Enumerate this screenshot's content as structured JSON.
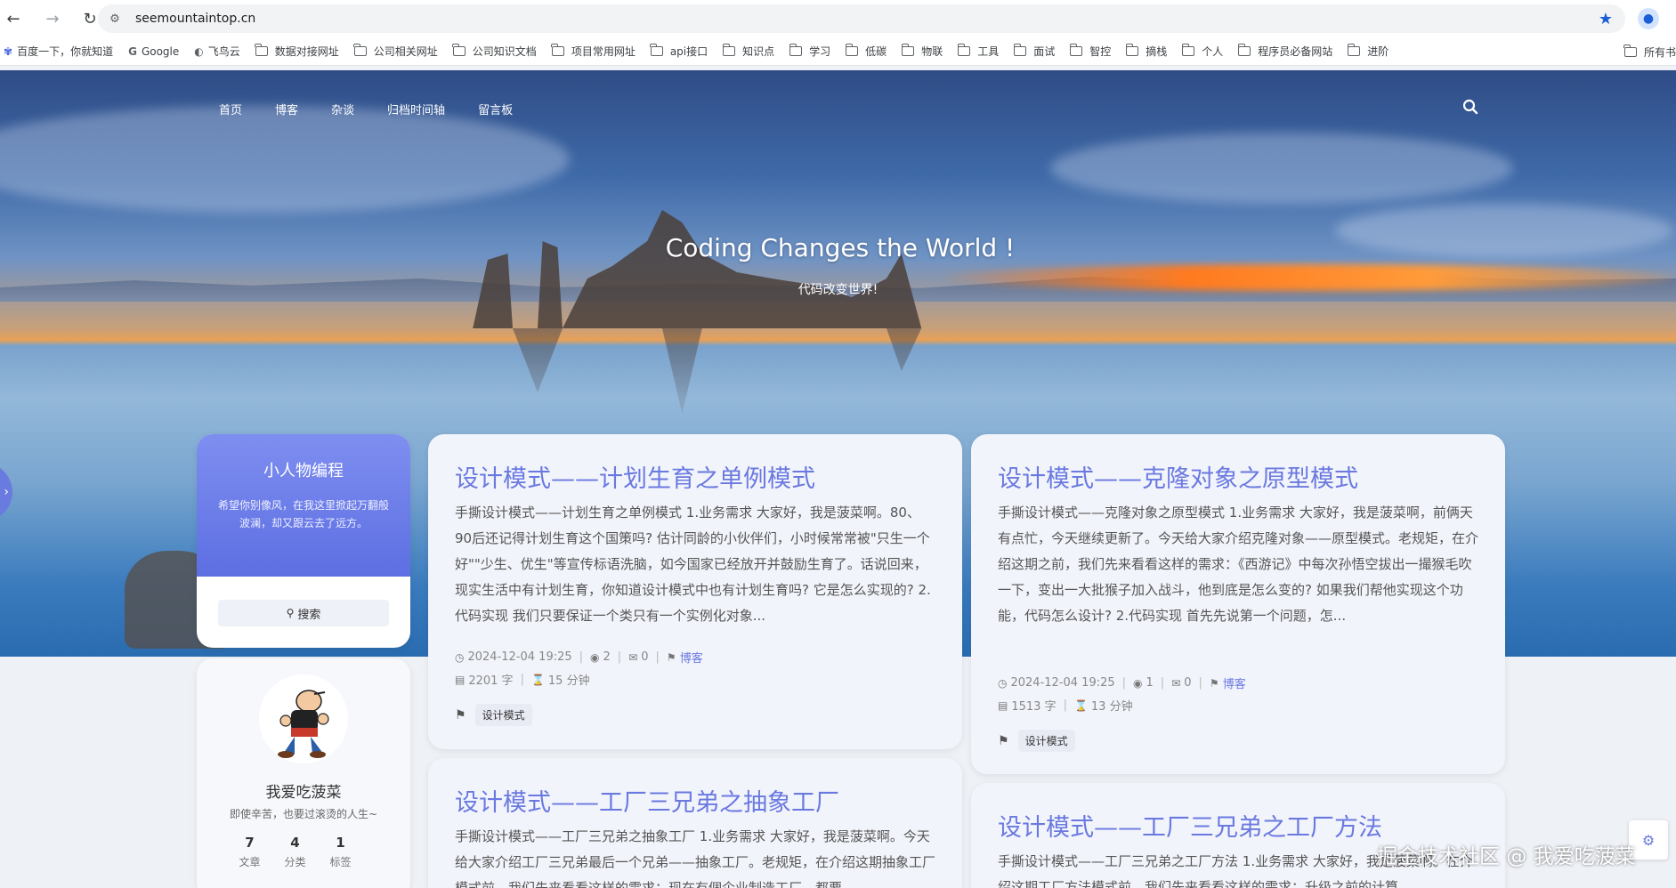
{
  "browser": {
    "url": "seemountaintop.cn",
    "bookmarks": [
      {
        "label": "百度一下，你就知道",
        "icon": "baidu-icon"
      },
      {
        "label": "Google",
        "icon": "google-icon"
      },
      {
        "label": "飞鸟云",
        "icon": "globe-icon"
      },
      {
        "label": "数据对接网址",
        "icon": "folder-icon"
      },
      {
        "label": "公司相关网址",
        "icon": "folder-icon"
      },
      {
        "label": "公司知识文档",
        "icon": "folder-icon"
      },
      {
        "label": "项目常用网址",
        "icon": "folder-icon"
      },
      {
        "label": "api接口",
        "icon": "folder-icon"
      },
      {
        "label": "知识点",
        "icon": "folder-icon"
      },
      {
        "label": "学习",
        "icon": "folder-icon"
      },
      {
        "label": "低碳",
        "icon": "folder-icon"
      },
      {
        "label": "物联",
        "icon": "folder-icon"
      },
      {
        "label": "工具",
        "icon": "folder-icon"
      },
      {
        "label": "面试",
        "icon": "folder-icon"
      },
      {
        "label": "智控",
        "icon": "folder-icon"
      },
      {
        "label": "摘栈",
        "icon": "folder-icon"
      },
      {
        "label": "个人",
        "icon": "folder-icon"
      },
      {
        "label": "程序员必备网站",
        "icon": "folder-icon"
      },
      {
        "label": "进阶",
        "icon": "folder-icon"
      }
    ],
    "bookmarks_overflow": "所有书"
  },
  "site": {
    "nav": [
      "首页",
      "博客",
      "杂谈",
      "归档时间轴",
      "留言板"
    ],
    "hero_title": "Coding Changes the World !",
    "hero_subtitle": "代码改变世界!"
  },
  "sidebar": {
    "intro_title": "小人物编程",
    "intro_desc": "希望你别像风，在我这里掀起万翻般波澜，却又跟云去了远方。",
    "search_label": "搜索",
    "author_name": "我爱吃菠菜",
    "author_motto": "即使辛苦，也要过滚烫的人生~",
    "stats": [
      {
        "num": "7",
        "label": "文章"
      },
      {
        "num": "4",
        "label": "分类"
      },
      {
        "num": "1",
        "label": "标签"
      }
    ]
  },
  "posts": [
    {
      "title": "设计模式——计划生育之单例模式",
      "excerpt": "手撕设计模式——计划生育之单例模式 1.业务需求 大家好，我是菠菜啊。80、90后还记得计划生育这个国策吗? 估计同龄的小伙伴们，小时候常常被\"只生一个好\"\"少生、优生\"等宣传标语洗脑，如今国家已经放开并鼓励生育了。话说回来，现实生活中有计划生育，你知道设计模式中也有计划生育吗? 它是怎么实现的? 2.代码实现 我们只要保证一个类只有一个实例化对象...",
      "date": "2024-12-04 19:25",
      "views": "2",
      "comments": "0",
      "category": "博客",
      "words": "2201 字",
      "read_time": "15 分钟",
      "tag": "设计模式"
    },
    {
      "title": "设计模式——克隆对象之原型模式",
      "excerpt": "手撕设计模式——克隆对象之原型模式 1.业务需求 大家好，我是菠菜啊，前俩天有点忙，今天继续更新了。今天给大家介绍克隆对象——原型模式。老规矩，在介绍这期之前，我们先来看看这样的需求：《西游记》中每次孙悟空拔出一撮猴毛吹一下，变出一大批猴子加入战斗，他到底是怎么变的? 如果我们帮他实现这个功能，代码怎么设计? 2.代码实现 首先先说第一个问题，怎...",
      "date": "2024-12-04 19:25",
      "views": "1",
      "comments": "0",
      "category": "博客",
      "words": "1513 字",
      "read_time": "13 分钟",
      "tag": "设计模式"
    },
    {
      "title": "设计模式——工厂三兄弟之抽象工厂",
      "excerpt": "手撕设计模式——工厂三兄弟之抽象工厂 1.业务需求 大家好，我是菠菜啊。今天给大家介绍工厂三兄弟最后一个兄弟——抽象工厂。老规矩，在介绍这期抽象工厂模式前，我们先来看看这样的需求：现在有個企业制造工厂，都要..."
    },
    {
      "title": "设计模式——工厂三兄弟之工厂方法",
      "excerpt": "手撕设计模式——工厂三兄弟之工厂方法 1.业务需求 大家好，我是菠菜啊。在介绍这期工厂方法模式前，我们先来看看这样的需求：升级之前的计算..."
    }
  ],
  "watermark": "掘金技术社区 @ 我爱吃菠菜"
}
